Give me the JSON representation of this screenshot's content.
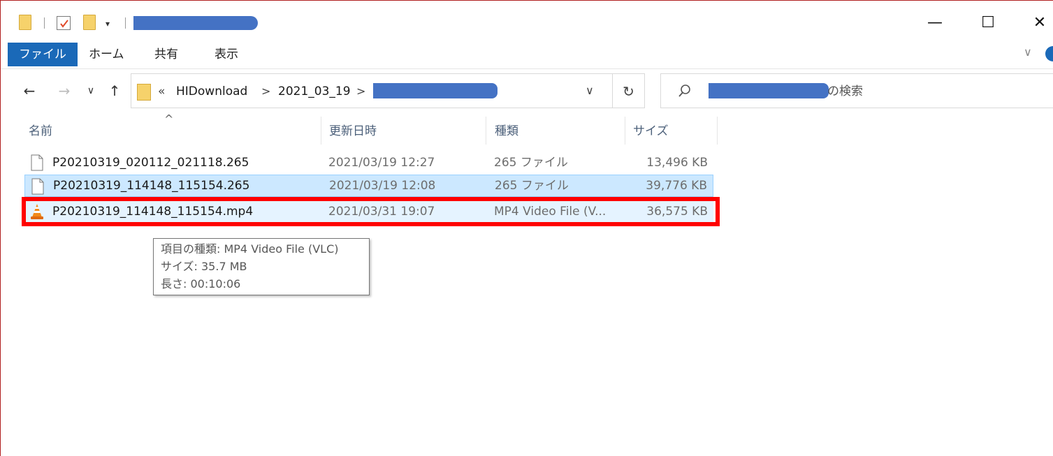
{
  "window": {
    "minimize_glyph": "—",
    "maximize_glyph": "☐",
    "close_glyph": "✕"
  },
  "ribbon": {
    "tabs": [
      "ファイル",
      "ホーム",
      "共有",
      "表示"
    ],
    "expand_glyph": "∨"
  },
  "nav": {
    "back_glyph": "←",
    "forward_glyph": "→",
    "recent_glyph": "∨",
    "up_glyph": "↑",
    "breadcrumb_prefix": "«",
    "breadcrumb": [
      "HIDownload",
      "2021_03_19"
    ],
    "breadcrumb_sep": ">",
    "address_dropdown_glyph": "∨",
    "refresh_glyph": "↻",
    "search_suffix": "の検索"
  },
  "columns": {
    "name": "名前",
    "modified": "更新日時",
    "type": "種類",
    "size": "サイズ",
    "sort_glyph": "^"
  },
  "files": [
    {
      "name": "P20210319_020112_021118.265",
      "modified": "2021/03/19 12:27",
      "type": "265 ファイル",
      "size": "13,496 KB",
      "icon": "document-icon"
    },
    {
      "name": "P20210319_114148_115154.265",
      "modified": "2021/03/19 12:08",
      "type": "265 ファイル",
      "size": "39,776 KB",
      "icon": "document-icon"
    },
    {
      "name": "P20210319_114148_115154.mp4",
      "modified": "2021/03/31 19:07",
      "type": "MP4 Video File (V...",
      "size": "36,575 KB",
      "icon": "vlc-cone-icon"
    }
  ],
  "tooltip": {
    "type_line": "項目の種類: MP4 Video File (VLC)",
    "size_line": "サイズ: 35.7 MB",
    "length_line": "長さ: 00:10:06"
  },
  "colors": {
    "accent": "#1a69b8",
    "selected_row": "#cce8ff",
    "highlight_box": "#ff0000",
    "redaction": "#4472c4"
  }
}
